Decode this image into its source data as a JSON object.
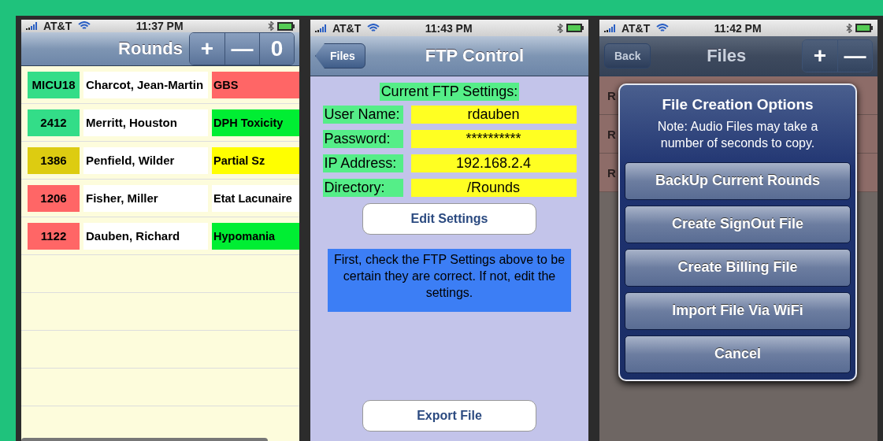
{
  "screens": [
    {
      "kind": "rounds",
      "status_bar": {
        "carrier": "AT&T",
        "time": "11:37 PM"
      },
      "nav_bar": {
        "title": "Rounds",
        "buttons": [
          "+",
          "—",
          "0"
        ]
      },
      "patients": [
        {
          "room": {
            "text": "MICU18",
            "color": "#33dd88"
          },
          "name": "Charcot, Jean-Martin",
          "diagnosis": {
            "text": "GBS",
            "color": "#ff6666"
          }
        },
        {
          "room": {
            "text": "2412",
            "color": "#33dd88"
          },
          "name": "Merritt, Houston",
          "diagnosis": {
            "text": "DPH Toxicity",
            "color": "#00ee33"
          }
        },
        {
          "room": {
            "text": "1386",
            "color": "#ddcc11"
          },
          "name": "Penfield, Wilder",
          "diagnosis": {
            "text": "Partial Sz",
            "color": "#ffff00"
          }
        },
        {
          "room": {
            "text": "1206",
            "color": "#ff6666"
          },
          "name": "Fisher, Miller",
          "diagnosis": {
            "text": "Etat Lacunaire",
            "color": "#ffffff"
          }
        },
        {
          "room": {
            "text": "1122",
            "color": "#ff6666"
          },
          "name": "Dauben, Richard",
          "diagnosis": {
            "text": "Hypomania",
            "color": "#00ee33"
          }
        }
      ]
    },
    {
      "kind": "ftp",
      "status_bar": {
        "carrier": "AT&T",
        "time": "11:43 PM"
      },
      "nav_bar": {
        "back": "Files",
        "title": "FTP Control"
      },
      "heading": "Current FTP Settings:",
      "fields": [
        {
          "label": "User Name:",
          "value": "rdauben"
        },
        {
          "label": "Password:",
          "value": "**********"
        },
        {
          "label": "IP Address:",
          "value": "192.168.2.4"
        },
        {
          "label": "Directory:",
          "value": "/Rounds"
        }
      ],
      "edit_button": "Edit Settings",
      "message": "First, check the FTP Settings above to be certain they are correct.  If not, edit the settings.",
      "export_button": "Export File"
    },
    {
      "kind": "files",
      "status_bar": {
        "carrier": "AT&T",
        "time": "11:42 PM"
      },
      "nav_bar": {
        "back": "Back",
        "title": "Files",
        "buttons": [
          "+",
          "—"
        ]
      },
      "file_rows": [
        "R",
        "R",
        "R"
      ],
      "dialog": {
        "title": "File Creation Options",
        "message": "Note: Audio Files may take a number of seconds to copy.",
        "buttons": [
          "BackUp Current Rounds",
          "Create SignOut File",
          "Create Billing File",
          "Import File Via WiFi",
          "Cancel"
        ]
      }
    }
  ]
}
